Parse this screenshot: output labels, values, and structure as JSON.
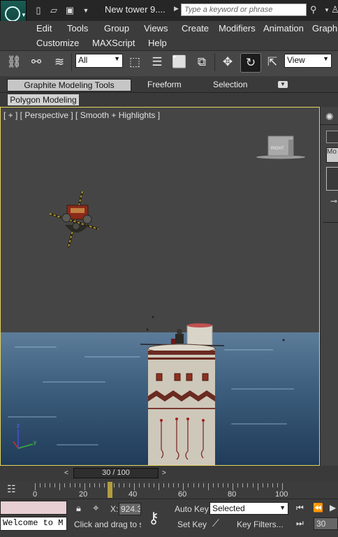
{
  "window": {
    "title": "New tower 9....",
    "search_placeholder": "Type a keyword or phrase"
  },
  "menu": {
    "row1": [
      "Edit",
      "Tools",
      "Group",
      "Views",
      "Create",
      "Modifiers",
      "Animation",
      "Graph"
    ],
    "row2": [
      "Customize",
      "MAXScript",
      "Help"
    ]
  },
  "toolbar": {
    "selection_filter": "All",
    "reference_coord": "View"
  },
  "ribbon": {
    "tabs": [
      "Graphite Modeling Tools",
      "Freeform",
      "Selection"
    ],
    "panel": "Polygon Modeling"
  },
  "viewport": {
    "label": "[ + ] [ Perspective ] [ Smooth + Highlights ]",
    "viewcube_face": "RIGHT"
  },
  "timeline": {
    "frame_display": "30 / 100",
    "ticks": [
      "0",
      "20",
      "40",
      "60",
      "80",
      "100"
    ]
  },
  "status": {
    "listener_text": "Welcome to M",
    "prompt": "Click and drag to se",
    "x_label": "X:",
    "x_value": "924.3",
    "auto_key": "Auto Key",
    "set_key": "Set Key",
    "key_mode": "Selected",
    "key_filters": "Key Filters...",
    "current_frame": "30"
  },
  "colors": {
    "viewport_border": "#e4d460",
    "key_marker": "#b49d3e",
    "sea": "#3e5f7e"
  }
}
